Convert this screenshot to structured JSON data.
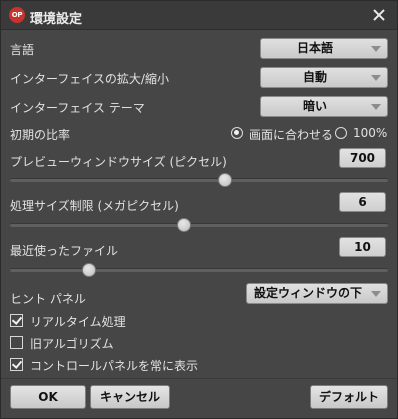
{
  "window": {
    "logo_text": "OP",
    "title": "環境設定"
  },
  "settings": {
    "language": {
      "label": "言語",
      "value": "日本語"
    },
    "ui_scale": {
      "label": "インターフェイスの拡大/縮小",
      "value": "自動"
    },
    "theme": {
      "label": "インターフェイス テーマ",
      "value": "暗い"
    },
    "initial_ratio": {
      "label": "初期の比率",
      "options": [
        {
          "label": "画面に合わせる",
          "selected": true
        },
        {
          "label": "100%",
          "selected": false
        }
      ]
    },
    "preview_size": {
      "label": "プレビューウィンドウサイズ (ピクセル)",
      "value": "700",
      "slider_fraction": 0.57
    },
    "processing_limit": {
      "label": "処理サイズ制限 (メガピクセル)",
      "value": "6",
      "slider_fraction": 0.46
    },
    "recent_files": {
      "label": "最近使ったファイル",
      "value": "10",
      "slider_fraction": 0.21
    },
    "hint_panel": {
      "label": "ヒント パネル",
      "value": "設定ウィンドウの下"
    }
  },
  "checkboxes": [
    {
      "label": "リアルタイム処理",
      "checked": true
    },
    {
      "label": "旧アルゴリズム",
      "checked": false
    },
    {
      "label": "コントロールパネルを常に表示",
      "checked": true
    }
  ],
  "buttons": {
    "ok": "OK",
    "cancel": "キャンセル",
    "default": "デフォルト"
  }
}
